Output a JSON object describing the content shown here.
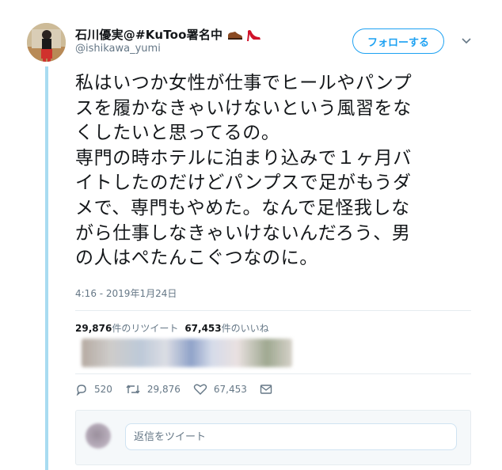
{
  "user": {
    "display_name": "石川優実@#KuToo署名中",
    "handle": "@ishikawa_yumi",
    "name_icons": [
      "mens-shoe-icon",
      "high-heel-icon"
    ]
  },
  "follow_button_label": "フォローする",
  "tweet": {
    "lines": [
      "私はいつか女性が仕事でヒールやパンプ",
      "スを履かなきゃいけないという風習をな",
      "くしたいと思ってるの。",
      "専門の時ホテルに泊まり込みで１ヶ月バ",
      "イトしたのだけどパンプスで足がもうダ",
      "メで、専門もやめた。なんで足怪我しな",
      "がら仕事しなきゃいけないんだろう、男",
      "の人はぺたんこぐつなのに。"
    ],
    "timestamp": "4:16 - 2019年1月24日"
  },
  "stats": {
    "retweets_count": "29,876",
    "retweets_label": "件のリツイート",
    "likes_count": "67,453",
    "likes_label": "件のいいね"
  },
  "actions": {
    "reply_count": "520",
    "retweet_count": "29,876",
    "like_count": "67,453"
  },
  "reply": {
    "placeholder": "返信をツイート"
  },
  "colors": {
    "accent": "#1da1f2",
    "thread_line": "#a8dcf1",
    "secondary_text": "#657786"
  }
}
